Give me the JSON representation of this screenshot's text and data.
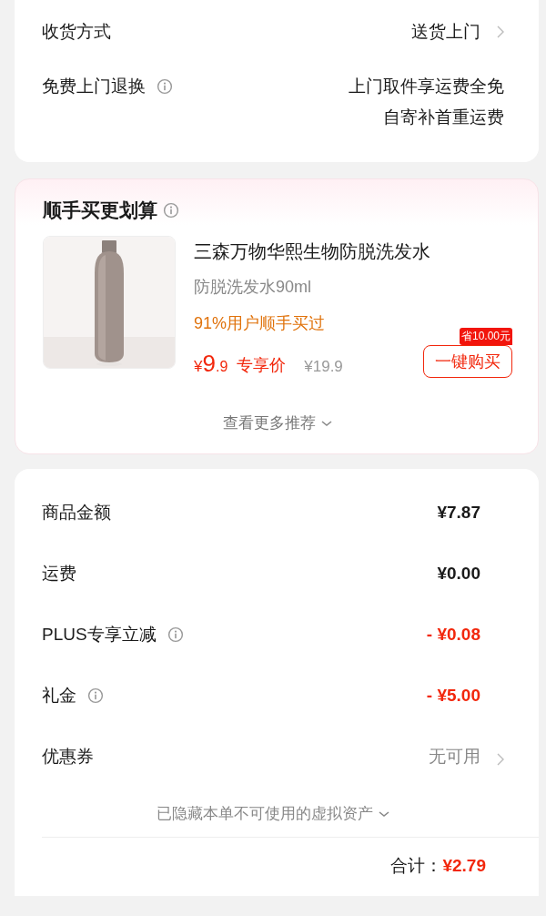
{
  "delivery": {
    "rows": [
      {
        "label": "收货方式",
        "info": false,
        "values": [
          "送货上门"
        ],
        "chevron": true
      },
      {
        "label": "免费上门退换",
        "info": true,
        "values": [
          "上门取件享运费全免",
          "自寄补首重运费"
        ],
        "chevron": false
      }
    ]
  },
  "bundle": {
    "title": "顺手买更划算",
    "info": true,
    "product": {
      "name": "三森万物华熙生物防脱洗发水",
      "spec": "防脱洗发水90ml",
      "social": "91%用户顺手买过",
      "price": {
        "currency": "¥",
        "integer": "9",
        "decimal": ".9"
      },
      "price_tag": "专享价",
      "original_price": "¥19.9",
      "save_badge": "省10.00元",
      "buy_button": "一键购买"
    },
    "more": "查看更多推荐"
  },
  "summary": {
    "rows": [
      {
        "kind": "plain",
        "label": "商品金额",
        "info": false,
        "value": "¥7.87"
      },
      {
        "kind": "plain",
        "label": "运费",
        "info": false,
        "value": "¥0.00"
      },
      {
        "kind": "deduction",
        "label": "PLUS专享立减",
        "info": true,
        "value": "- ¥0.08"
      },
      {
        "kind": "deduction",
        "label": "礼金",
        "info": true,
        "value": "- ¥5.00"
      },
      {
        "kind": "link",
        "label": "优惠券",
        "info": false,
        "value": "无可用"
      }
    ],
    "hidden_note": "已隐藏本单不可使用的虚拟资产",
    "total_label": "合计：",
    "total_value": "¥2.79"
  }
}
